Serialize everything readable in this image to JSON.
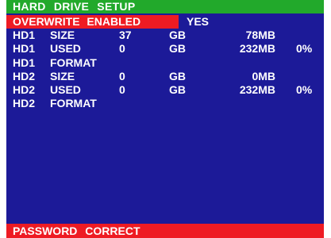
{
  "header": {
    "title": "HARD  DRIVE  SETUP"
  },
  "overwrite": {
    "label": "OVERWRITE  ENABLED",
    "value": "YES"
  },
  "rows": [
    {
      "drive": "HD1",
      "field": "SIZE",
      "num": "37",
      "unit": "GB",
      "mb": "78MB",
      "pct": ""
    },
    {
      "drive": "HD1",
      "field": "USED",
      "num": "0",
      "unit": "GB",
      "mb": "232MB",
      "pct": "0%"
    },
    {
      "drive": "HD1",
      "field": "FORMAT",
      "num": "",
      "unit": "",
      "mb": "",
      "pct": ""
    },
    {
      "drive": "HD2",
      "field": "SIZE",
      "num": "0",
      "unit": "GB",
      "mb": "0MB",
      "pct": ""
    },
    {
      "drive": "HD2",
      "field": "USED",
      "num": "0",
      "unit": "GB",
      "mb": "232MB",
      "pct": "0%"
    },
    {
      "drive": "HD2",
      "field": "FORMAT",
      "num": "",
      "unit": "",
      "mb": "",
      "pct": ""
    }
  ],
  "status": {
    "message": "PASSWORD  CORRECT"
  },
  "colors": {
    "background": "#1c1a98",
    "title_bar": "#22a92b",
    "highlight": "#ee1b23",
    "text": "#ffffff"
  }
}
